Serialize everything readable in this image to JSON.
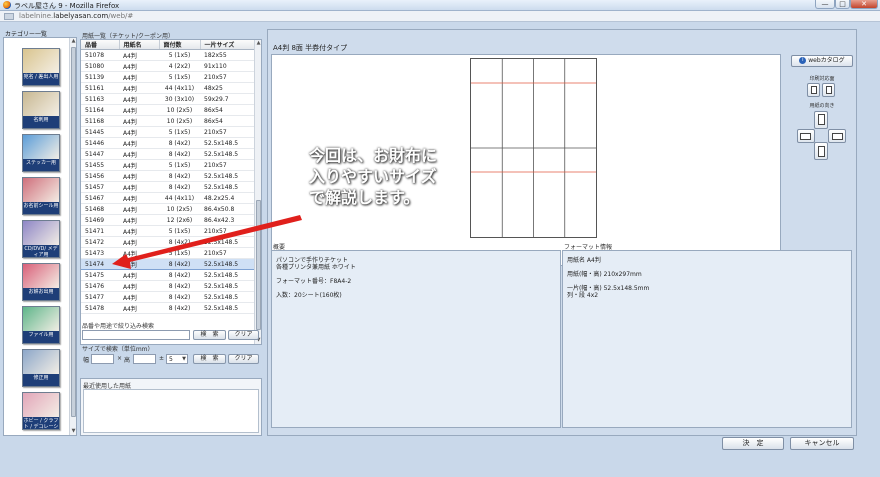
{
  "window": {
    "title": "ラベル屋さん 9 - Mozilla Firefox",
    "url_prefix": "labelnine.",
    "url_host": "labelyasan.com",
    "url_suffix": "/web/#",
    "minimize": "—",
    "maximize": "□",
    "close": "✕"
  },
  "categories": {
    "title": "カテゴリー一覧",
    "items": [
      {
        "label": "宛名 / 差出人用",
        "color": "#d9c48e"
      },
      {
        "label": "名刺用",
        "color": "#c8b892"
      },
      {
        "label": "ステッカー用",
        "color": "#5b9dd8"
      },
      {
        "label": "お名前シール用",
        "color": "#cf6f7c"
      },
      {
        "label": "CD/DVD/ メディア用",
        "color": "#8e86c6"
      },
      {
        "label": "お餅お出用",
        "color": "#d9607a"
      },
      {
        "label": "ファイル用",
        "color": "#5eb58a"
      },
      {
        "label": "修正用",
        "color": "#8da7c9"
      },
      {
        "label": "ホビー / クラフト / デコレーション用",
        "color": "#e2a6b9"
      }
    ]
  },
  "paper_list": {
    "heading": "用紙一覧（チケット/クーポン用）",
    "columns": [
      "品番",
      "用紙名",
      "面付数",
      "一片サイズ"
    ],
    "rows": [
      [
        "51078",
        "A4判",
        "5 (1x5)",
        "182x55"
      ],
      [
        "51080",
        "A4判",
        "4 (2x2)",
        "91x110"
      ],
      [
        "51139",
        "A4判",
        "5 (1x5)",
        "210x57"
      ],
      [
        "51161",
        "A4判",
        "44 (4x11)",
        "48x25"
      ],
      [
        "51163",
        "A4判",
        "30 (3x10)",
        "59x29.7"
      ],
      [
        "51164",
        "A4判",
        "10 (2x5)",
        "86x54"
      ],
      [
        "51168",
        "A4判",
        "10 (2x5)",
        "86x54"
      ],
      [
        "51445",
        "A4判",
        "5 (1x5)",
        "210x57"
      ],
      [
        "51446",
        "A4判",
        "8 (4x2)",
        "52.5x148.5"
      ],
      [
        "51447",
        "A4判",
        "8 (4x2)",
        "52.5x148.5"
      ],
      [
        "51455",
        "A4判",
        "5 (1x5)",
        "210x57"
      ],
      [
        "51456",
        "A4判",
        "8 (4x2)",
        "52.5x148.5"
      ],
      [
        "51457",
        "A4判",
        "8 (4x2)",
        "52.5x148.5"
      ],
      [
        "51467",
        "A4判",
        "44 (4x11)",
        "48.2x25.4"
      ],
      [
        "51468",
        "A4判",
        "10 (2x5)",
        "86.4x50.8"
      ],
      [
        "51469",
        "A4判",
        "12 (2x6)",
        "86.4x42.3"
      ],
      [
        "51471",
        "A4判",
        "5 (1x5)",
        "210x57"
      ],
      [
        "51472",
        "A4判",
        "8 (4x2)",
        "52.5x148.5"
      ],
      [
        "51473",
        "A4判",
        "5 (1x5)",
        "210x57"
      ],
      [
        "51474",
        "A4判",
        "8 (4x2)",
        "52.5x148.5"
      ],
      [
        "51475",
        "A4判",
        "8 (4x2)",
        "52.5x148.5"
      ],
      [
        "51476",
        "A4判",
        "8 (4x2)",
        "52.5x148.5"
      ],
      [
        "51477",
        "A4判",
        "8 (4x2)",
        "52.5x148.5"
      ],
      [
        "51478",
        "A4判",
        "8 (4x2)",
        "52.5x148.5"
      ]
    ],
    "selected_code": "51474"
  },
  "search": {
    "by_name_label": "品番や用途で絞り込み検索",
    "search_btn": "検　索",
    "clear_btn": "クリア",
    "by_size_label": "サイズで検索（単位mm）",
    "width_label": "幅",
    "times": "×",
    "height_label": "高",
    "plusminus": "±",
    "tolerance": "5",
    "dropdown_arrow": "▼"
  },
  "recent": {
    "heading": "最近使用した用紙"
  },
  "main": {
    "title": "A4判 8面 半券付タイプ",
    "web_catalog": "webカタログ",
    "print_side_label": "印刷対応面",
    "orientation_label": "用紙の向き",
    "summary_heading": "概要",
    "summary_lines": [
      "パソコンで手作りチケット",
      "各種プリンタ兼用紙 ホワイト",
      "",
      "フォーマット番号：F8A4-2",
      "",
      "入数：20シート(160枚)"
    ],
    "format_heading": "フォーマット情報",
    "format_lines": [
      "用紙名  A4判",
      "",
      "用紙(幅・高)  210x297mm",
      "",
      "一片(幅・高)  52.5x148.5mm",
      "列・段  4x2"
    ]
  },
  "footer": {
    "ok": "決　定",
    "cancel": "キャンセル"
  },
  "annotation": {
    "line1": "今回は、お財布に",
    "line2": "入りやすいサイズ",
    "line3": "で解説します。",
    "arrow_color": "#e0201c"
  }
}
